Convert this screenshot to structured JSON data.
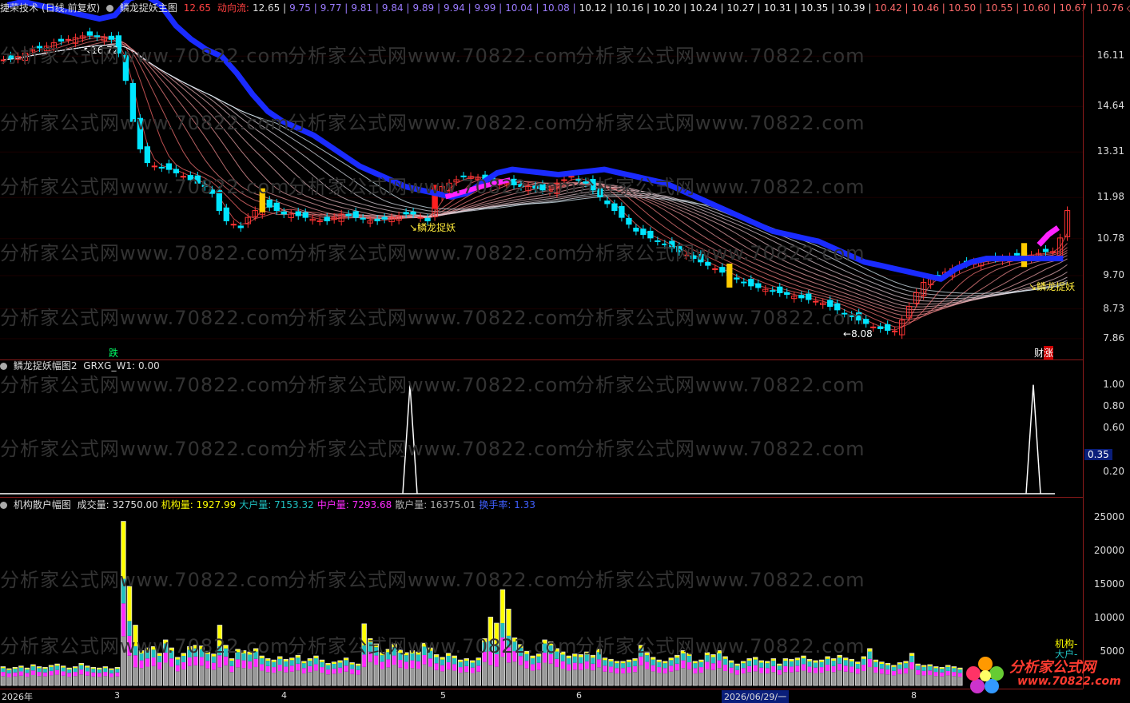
{
  "main_header": {
    "app": "捷荣技术",
    "mode": "(日线,前复权)",
    "indicator": "鳞龙捉妖主图",
    "first_value": "12.65",
    "flow_label": "动向流:",
    "flow_values": [
      "12.65",
      "9.75",
      "9.77",
      "9.81",
      "9.84",
      "9.89",
      "9.94",
      "9.99",
      "10.04",
      "10.08",
      "10.12",
      "10.16",
      "10.20",
      "10.24",
      "10.27",
      "10.31",
      "10.35",
      "10.39",
      "10.42",
      "10.46",
      "10.50",
      "10.55",
      "10.60",
      "10.67",
      "10.76"
    ]
  },
  "sub1_header": {
    "title": "鳞龙捉妖幅图2",
    "label": "GRXG_W1:",
    "value": "0.00"
  },
  "sub2_header": {
    "title": "机构散户幅图",
    "items": [
      {
        "label": "成交量:",
        "value": "32750.00",
        "color": "#dddddd"
      },
      {
        "label": "机构量:",
        "value": "1927.99",
        "color": "#ffff00"
      },
      {
        "label": "大户量:",
        "value": "7153.32",
        "color": "#20c0c0"
      },
      {
        "label": "中户量:",
        "value": "7293.68",
        "color": "#ff2bff"
      },
      {
        "label": "散户量:",
        "value": "16375.01",
        "color": "#aaaaaa"
      },
      {
        "label": "换手率:",
        "value": "1.33",
        "color": "#4060ff"
      }
    ]
  },
  "watermark": "分析家公式网www.70822.com",
  "annotations": {
    "high_marker": "16.72",
    "low_marker": "8.08",
    "signal_label": "鳞龙捉妖",
    "die_label": "跌",
    "cai_label": "财",
    "zhang_label": "涨",
    "jigou_label": "机构-",
    "dahu_label": "大户-"
  },
  "x_axis_labels": [
    "2026年",
    "3",
    "4",
    "5",
    "6",
    "2026/06/29/一",
    "8"
  ],
  "logo": {
    "title": "分析家公式网",
    "url": "www.70822.com"
  },
  "colors": {
    "up": "#ff3333",
    "down": "#00e5ff",
    "ma_blue": "#1a2bff",
    "ma_magenta": "#ff22ff",
    "grid_red": "#8b1a1a"
  },
  "chart_data": [
    {
      "type": "candlestick",
      "title": "鳞龙捉妖主图",
      "y_ticks": [
        16.11,
        14.64,
        13.31,
        11.98,
        10.78,
        9.7,
        8.73,
        7.86
      ],
      "ylim": [
        7.6,
        17.4
      ],
      "close_series": [
        16.0,
        16.05,
        16.1,
        16.2,
        16.3,
        16.35,
        16.4,
        16.5,
        16.55,
        16.6,
        16.65,
        16.7,
        16.72,
        16.68,
        16.65,
        16.6,
        16.2,
        15.4,
        14.2,
        13.4,
        13.0,
        12.9,
        12.85,
        12.8,
        12.7,
        12.6,
        12.5,
        12.4,
        12.3,
        12.1,
        11.6,
        11.3,
        11.2,
        11.1,
        11.4,
        11.6,
        11.9,
        11.7,
        11.6,
        11.5,
        11.5,
        11.45,
        11.4,
        11.35,
        11.3,
        11.3,
        11.4,
        11.5,
        11.45,
        11.4,
        11.35,
        11.3,
        11.3,
        11.35,
        11.4,
        11.45,
        11.5,
        11.5,
        11.4,
        11.3,
        12.0,
        12.3,
        12.4,
        12.5,
        12.6,
        12.6,
        12.55,
        12.5,
        12.45,
        12.4,
        12.4,
        12.35,
        12.3,
        12.3,
        12.25,
        12.2,
        12.2,
        12.4,
        12.5,
        12.6,
        12.5,
        12.4,
        12.2,
        12.0,
        11.8,
        11.6,
        11.4,
        11.2,
        11.0,
        10.9,
        10.8,
        10.7,
        10.6,
        10.5,
        10.4,
        10.3,
        10.2,
        10.1,
        10.0,
        9.9,
        9.8,
        9.7,
        9.6,
        9.5,
        9.4,
        9.35,
        9.3,
        9.25,
        9.2,
        9.15,
        9.1,
        9.05,
        9.0,
        8.95,
        8.9,
        8.8,
        8.7,
        8.6,
        8.5,
        8.4,
        8.3,
        8.2,
        8.15,
        8.1,
        8.08,
        8.4,
        8.8,
        9.2,
        9.5,
        9.6,
        9.7,
        9.8,
        9.9,
        10.0,
        10.05,
        10.1,
        10.1,
        10.15,
        10.2,
        10.2,
        10.25,
        10.3,
        10.3,
        10.3,
        10.35,
        10.4,
        10.4,
        10.8,
        11.6
      ],
      "ma_blue": [
        17.6,
        17.7,
        17.6,
        17.5,
        17.4,
        17.3,
        17.2,
        17.3,
        17.8,
        17.9,
        17.6,
        17.0,
        16.6,
        16.3,
        16.1,
        15.6,
        15.0,
        14.5,
        14.2,
        14.0,
        13.8,
        13.5,
        13.2,
        12.9,
        12.7,
        12.5,
        12.3,
        12.2,
        12.1,
        12.0,
        12.1,
        12.4,
        12.7,
        12.8,
        12.75,
        12.7,
        12.65,
        12.7,
        12.75,
        12.8,
        12.7,
        12.6,
        12.5,
        12.4,
        12.2,
        12.0,
        11.8,
        11.6,
        11.4,
        11.2,
        11.0,
        10.9,
        10.8,
        10.7,
        10.5,
        10.3,
        10.1,
        10.0,
        9.9,
        9.8,
        9.7,
        9.6,
        9.9,
        10.1,
        10.2,
        10.2,
        10.2,
        10.2,
        10.2,
        10.2
      ],
      "markers": [
        {
          "type": "high",
          "label_key": "high_marker",
          "x_index": 12,
          "value": 16.72
        },
        {
          "type": "low",
          "label_key": "low_marker",
          "x_index": 124,
          "value": 8.08
        }
      ]
    },
    {
      "type": "line",
      "title": "鳞龙捉妖幅图2",
      "series": [
        {
          "name": "GRXG_W1",
          "spikes": [
            {
              "position": "signal 1",
              "value": 1.0
            },
            {
              "position": "signal 2",
              "value": 1.0
            }
          ]
        }
      ],
      "y_ticks": [
        1.0,
        0.8,
        0.6,
        0.35,
        0.2
      ],
      "ylim": [
        0,
        1.1
      ]
    },
    {
      "type": "bar",
      "title": "机构散户幅图",
      "y_ticks": [
        25000,
        20000,
        15000,
        10000,
        5000
      ],
      "ylim": [
        0,
        26000
      ],
      "volume_series": [
        2800,
        2500,
        2700,
        2900,
        2600,
        3100,
        2800,
        2700,
        3000,
        3200,
        2900,
        2600,
        2800,
        3300,
        2900,
        2700,
        2600,
        2800,
        2500,
        2700,
        24500,
        14800,
        9000,
        5200,
        5600,
        5800,
        4800,
        6800,
        5600,
        4200,
        4800,
        5800,
        6000,
        5900,
        5100,
        4700,
        9000,
        6000,
        4000,
        5400,
        5200,
        5000,
        5500,
        4400,
        4000,
        3800,
        4300,
        3900,
        4100,
        4500,
        3600,
        4000,
        4400,
        3800,
        3300,
        3500,
        3700,
        4100,
        3400,
        3200,
        9200,
        7000,
        6200,
        4900,
        5400,
        6200,
        5300,
        4900,
        5200,
        5000,
        6300,
        5600,
        4600,
        4200,
        4800,
        4400,
        3800,
        4000,
        3700,
        4100,
        7000,
        10200,
        9300,
        14300,
        11400,
        7100,
        6100,
        5100,
        4400,
        4700,
        6800,
        6500,
        5500,
        5000,
        4400,
        4700,
        4600,
        5000,
        4500,
        5400,
        4100,
        3900,
        3600,
        3600,
        3800,
        4000,
        6000,
        4900,
        4200,
        3800,
        3600,
        4100,
        4500,
        5200,
        4800,
        3600,
        3800,
        4900,
        4600,
        5200,
        4300,
        3700,
        3200,
        3600,
        4000,
        4200,
        3700,
        3600,
        4000,
        3200,
        4000,
        3900,
        4100,
        4400,
        3900,
        3700,
        3800,
        4300,
        4000,
        4500,
        4100,
        3900,
        3500,
        4300,
        5500,
        3800,
        3500,
        3300,
        3000,
        3400,
        3600,
        4800,
        3200,
        3000,
        3100,
        2800,
        2700,
        3000,
        2800,
        2600
      ]
    }
  ]
}
